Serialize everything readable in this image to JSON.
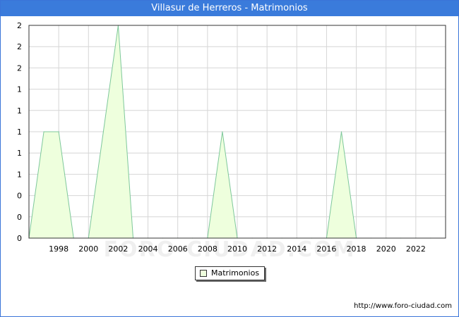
{
  "header": {
    "title": "Villasur de Herreros - Matrimonios"
  },
  "footer": {
    "url": "http://www.foro-ciudad.com"
  },
  "watermark": {
    "text": "FORO-CIUDAD.COM"
  },
  "colors": {
    "fill": "#eeffdd",
    "line": "#7ec89b",
    "grid": "#d6d6d6",
    "header": "#3a7bdb"
  },
  "chart_data": {
    "type": "area",
    "title": "Villasur de Herreros - Matrimonios",
    "xlabel": "",
    "ylabel": "",
    "xlim": [
      1996,
      2024
    ],
    "ylim": [
      0,
      2
    ],
    "grid": true,
    "legend_position": "bottom",
    "x_ticks": [
      1998,
      2000,
      2002,
      2004,
      2006,
      2008,
      2010,
      2012,
      2014,
      2016,
      2018,
      2020,
      2022
    ],
    "y_tick_values": [
      0,
      0.2,
      0.4,
      0.6,
      0.8,
      1,
      1.2,
      1.4,
      1.6,
      1.8,
      2
    ],
    "y_tick_labels": [
      "0",
      "0",
      "0",
      "1",
      "1",
      "1",
      "1",
      "1",
      "2",
      "2",
      "2"
    ],
    "series": [
      {
        "name": "Matrimonios",
        "x": [
          1996,
          1997,
          1998,
          1999,
          2000,
          2001,
          2002,
          2003,
          2004,
          2005,
          2006,
          2007,
          2008,
          2009,
          2010,
          2011,
          2012,
          2013,
          2014,
          2015,
          2016,
          2017,
          2018,
          2019,
          2020,
          2021,
          2022,
          2023
        ],
        "values": [
          0,
          1,
          1,
          0,
          0,
          1,
          2,
          0,
          0,
          0,
          0,
          0,
          0,
          1,
          0,
          0,
          0,
          0,
          0,
          0,
          0,
          1,
          0,
          0,
          0,
          0,
          0,
          0
        ]
      }
    ]
  }
}
